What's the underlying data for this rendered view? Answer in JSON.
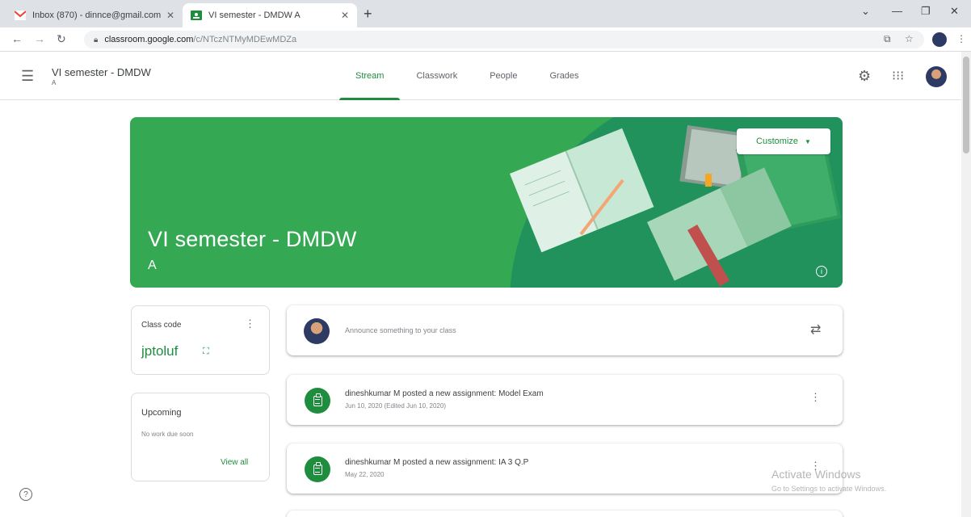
{
  "browser": {
    "tabs": [
      {
        "title": "Inbox (870) - dinnce@gmail.com",
        "icon": "gmail-icon"
      },
      {
        "title": "VI semester - DMDW A",
        "icon": "classroom-icon"
      }
    ],
    "url_host": "classroom.google.com",
    "url_path": "/c/NTczNTMyMDEwMDZa"
  },
  "header": {
    "class_title": "VI semester - DMDW",
    "class_section": "A",
    "tabs": [
      "Stream",
      "Classwork",
      "People",
      "Grades"
    ],
    "active_tab": "Stream"
  },
  "banner": {
    "title": "VI semester - DMDW",
    "section": "A",
    "customize_label": "Customize",
    "color": "#34a853"
  },
  "class_code": {
    "label": "Class code",
    "value": "jptoluf"
  },
  "upcoming": {
    "label": "Upcoming",
    "empty_text": "No work due soon",
    "view_all": "View all"
  },
  "announce": {
    "placeholder": "Announce something to your class"
  },
  "posts": [
    {
      "title": "dineshkumar M posted a new assignment: Model Exam",
      "date": "Jun 10, 2020 (Edited Jun 10, 2020)"
    },
    {
      "title": "dineshkumar M posted a new assignment: IA 3 Q.P",
      "date": "May 22, 2020"
    }
  ],
  "watermark": {
    "title": "Activate Windows",
    "sub": "Go to Settings to activate Windows."
  },
  "colors": {
    "accent": "#1e8e3e",
    "banner": "#34a853"
  }
}
